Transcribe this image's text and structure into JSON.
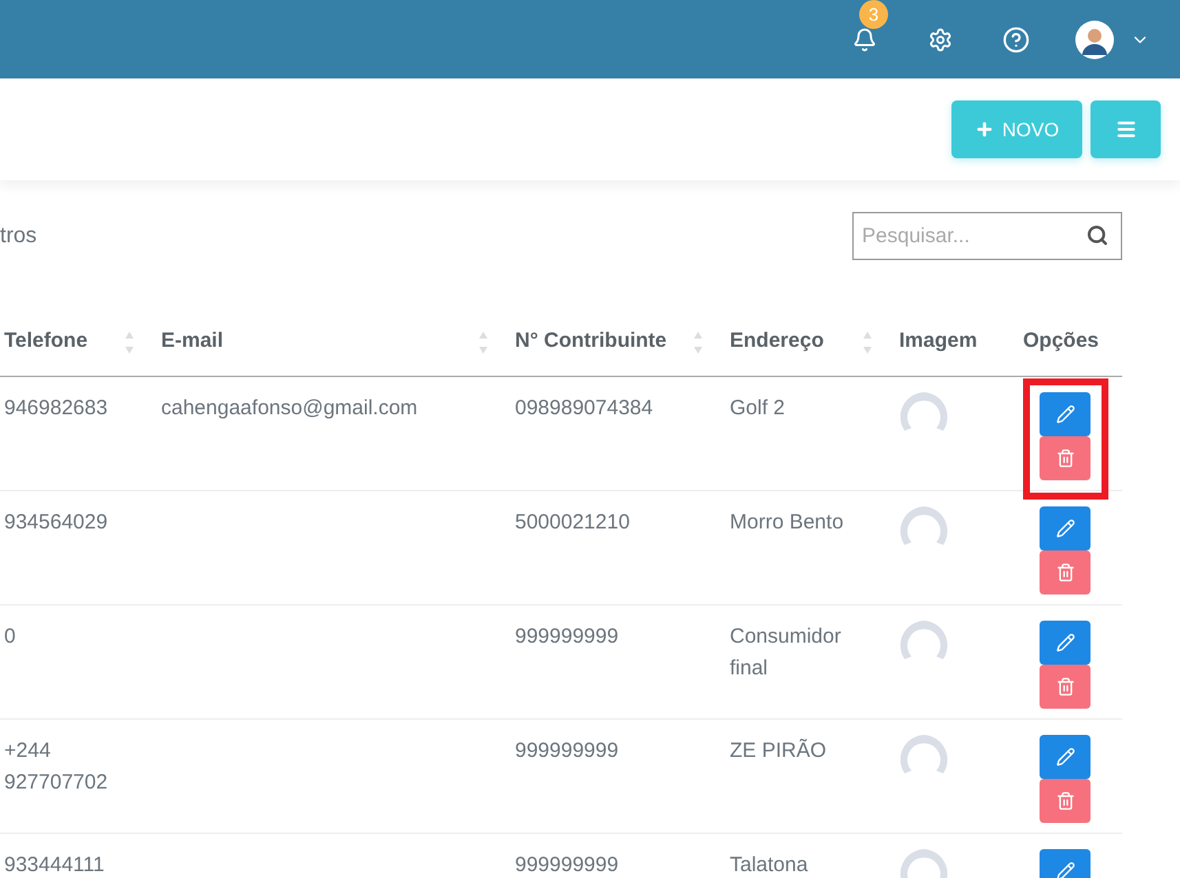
{
  "topbar": {
    "notification_count": "3"
  },
  "toolbar": {
    "buttons": [
      {
        "kind": "new",
        "label": "NOVO"
      },
      {
        "kind": "menu"
      }
    ]
  },
  "records_text": "tros",
  "search": {
    "placeholder": "Pesquisar..."
  },
  "table": {
    "columns": [
      {
        "label": "Telefone",
        "sortable": true
      },
      {
        "label": "E-mail",
        "sortable": true
      },
      {
        "label": "N° Contribuinte",
        "sortable": true
      },
      {
        "label": "Endereço",
        "sortable": true
      },
      {
        "label": "Imagem",
        "sortable": false
      },
      {
        "label": "Opções",
        "sortable": false
      }
    ],
    "rows": [
      {
        "telefone": "946982683",
        "email": "cahengaafonso@gmail.com",
        "contribuinte": "098989074384",
        "endereco": "Golf 2",
        "highlighted": true,
        "actions": [
          {
            "kind": "edit"
          },
          {
            "kind": "delete"
          }
        ]
      },
      {
        "telefone": "934564029",
        "email": "",
        "contribuinte": "5000021210",
        "endereco": "Morro Bento",
        "highlighted": false,
        "actions": [
          {
            "kind": "edit"
          },
          {
            "kind": "delete"
          }
        ]
      },
      {
        "telefone": "0",
        "email": "",
        "contribuinte": "999999999",
        "endereco": "Consumidor final",
        "highlighted": false,
        "actions": [
          {
            "kind": "edit"
          },
          {
            "kind": "delete"
          }
        ]
      },
      {
        "telefone": "+244 927707702",
        "email": "",
        "contribuinte": "999999999",
        "endereco": "ZE PIRÃO",
        "highlighted": false,
        "actions": [
          {
            "kind": "edit"
          },
          {
            "kind": "delete"
          }
        ]
      },
      {
        "telefone": "933444111",
        "email": "",
        "contribuinte": "999999999",
        "endereco": "Talatona",
        "highlighted": false,
        "actions": [
          {
            "kind": "edit"
          }
        ]
      }
    ]
  }
}
